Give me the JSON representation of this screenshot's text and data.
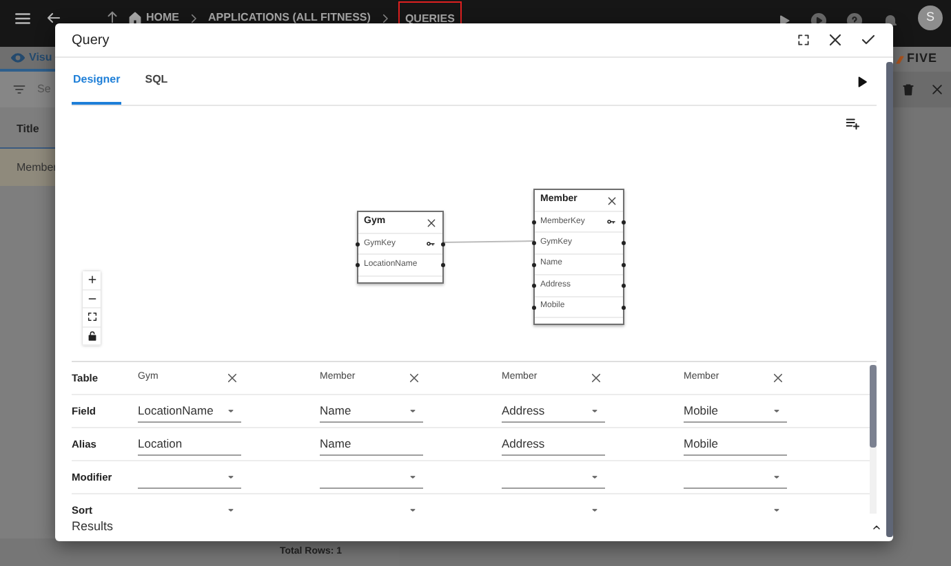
{
  "topbar": {
    "breadcrumbs": [
      {
        "label": "HOME",
        "highlighted": false
      },
      {
        "label": "APPLICATIONS (ALL FITNESS)",
        "highlighted": false
      },
      {
        "label": "QUERIES",
        "highlighted": true
      }
    ],
    "avatar": "S"
  },
  "background": {
    "tab": "Visu",
    "search_placeholder": "Se",
    "column_header": "Title",
    "rows": [
      "Member"
    ],
    "footer": "Total Rows: 1",
    "logo": "FIVE"
  },
  "dialog": {
    "title": "Query",
    "tabs": [
      {
        "label": "Designer",
        "selected": true
      },
      {
        "label": "SQL",
        "selected": false
      }
    ],
    "tables": [
      {
        "name": "Gym",
        "fields": [
          {
            "name": "GymKey",
            "key": true
          },
          {
            "name": "LocationName",
            "key": false
          }
        ]
      },
      {
        "name": "Member",
        "fields": [
          {
            "name": "MemberKey",
            "key": true
          },
          {
            "name": "GymKey",
            "key": false
          },
          {
            "name": "Name",
            "key": false
          },
          {
            "name": "Address",
            "key": false
          },
          {
            "name": "Mobile",
            "key": false
          }
        ]
      }
    ],
    "grid": {
      "row_labels": [
        "Table",
        "Field",
        "Alias",
        "Modifier",
        "Sort"
      ],
      "columns": [
        {
          "table": "Gym",
          "field": "LocationName",
          "alias": "Location"
        },
        {
          "table": "Member",
          "field": "Name",
          "alias": "Name"
        },
        {
          "table": "Member",
          "field": "Address",
          "alias": "Address"
        },
        {
          "table": "Member",
          "field": "Mobile",
          "alias": "Mobile"
        }
      ]
    },
    "results": "Results"
  }
}
